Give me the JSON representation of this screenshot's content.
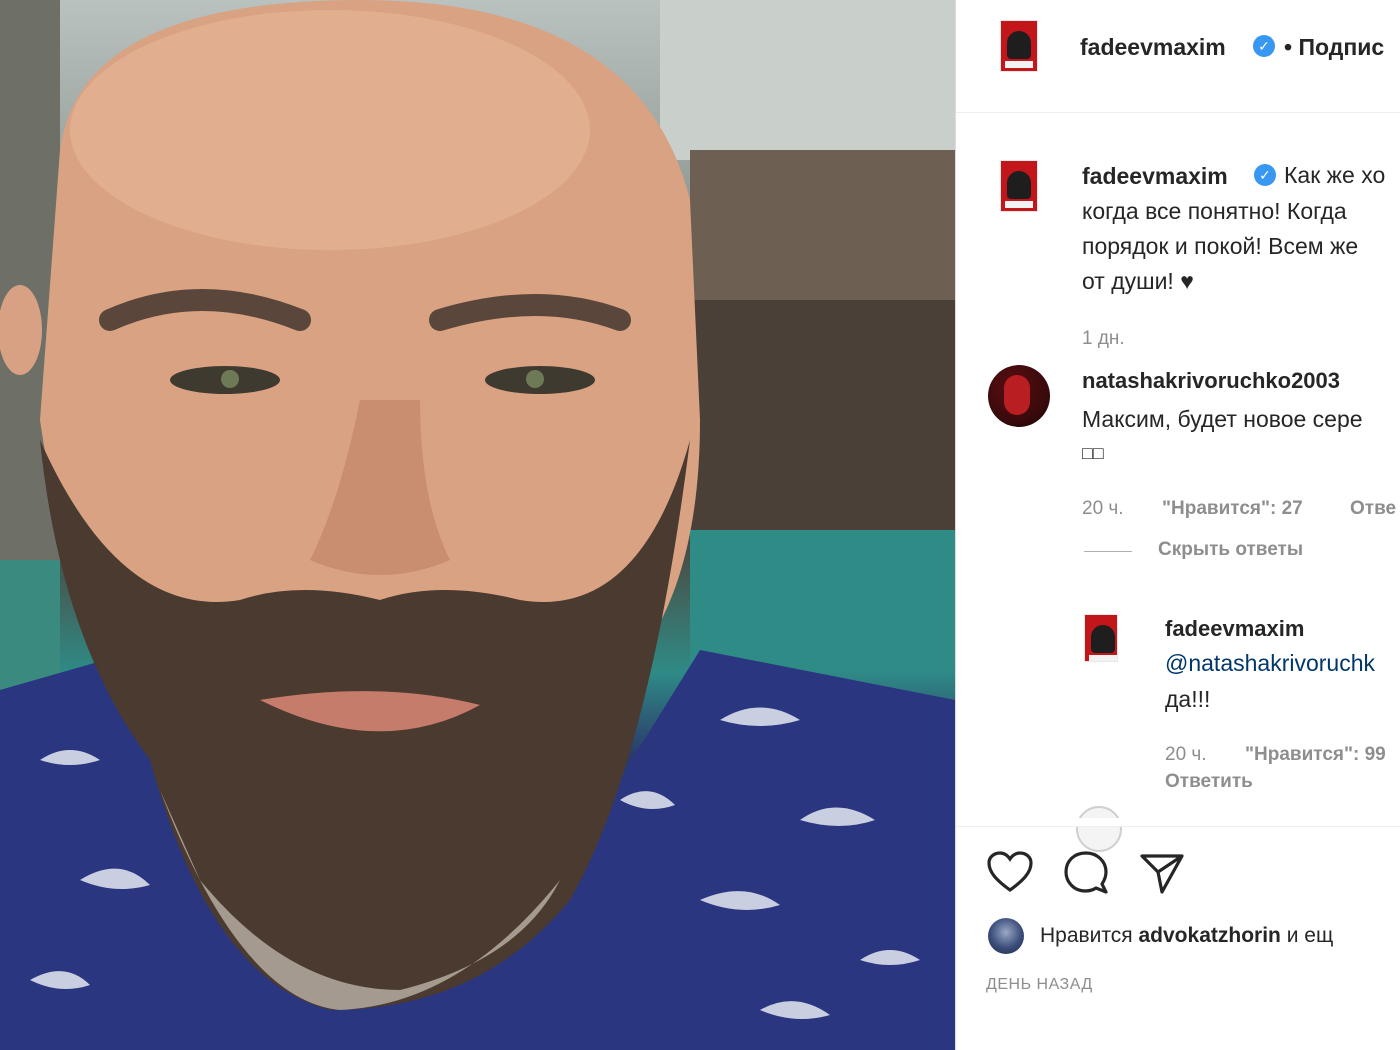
{
  "post": {
    "author": "fadeevmaxim",
    "header_follow": "• Подпис",
    "caption_lines": [
      "Как же хо",
      "когда все понятно! Когда",
      "порядок и покой! Всем же",
      "от души! "
    ],
    "caption_heart": "♥",
    "caption_time": "1 дн."
  },
  "comments": [
    {
      "user": "natashakrivoruchko2003",
      "text_lines": [
        "Максим, будет новое сере",
        "□□"
      ],
      "time": "20 ч.",
      "likes": "\"Нравится\": 27",
      "reply": "Отве",
      "hide_replies": "Скрыть ответы"
    }
  ],
  "reply": {
    "user": "fadeevmaxim",
    "text_lines": [
      "@natashakrivoruchk",
      "да!!!"
    ],
    "time": "20 ч.",
    "likes": "\"Нравится\": 99",
    "reply_label": "Ответить"
  },
  "actions": {
    "like_icon": "heart-outline-icon",
    "comment_icon": "comment-bubble-icon",
    "share_icon": "paper-plane-icon"
  },
  "likes_line": {
    "prefix": "Нравится ",
    "user": "advokatzhorin",
    "suffix": " и ещ"
  },
  "date_caption": "ДЕНЬ НАЗАД",
  "colors": {
    "verified": "#3897f0",
    "meta": "#8e8e8e",
    "text": "#262626"
  }
}
